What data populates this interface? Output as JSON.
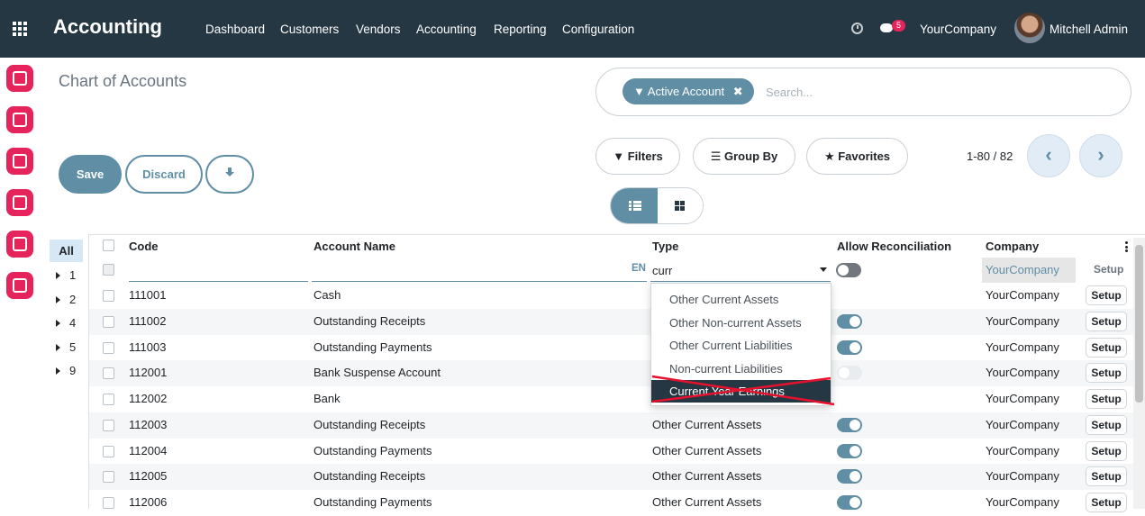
{
  "topbar": {
    "app_name": "Accounting",
    "menu": [
      "Dashboard",
      "Customers",
      "Vendors",
      "Accounting",
      "Reporting",
      "Configuration"
    ],
    "messages_count": "5",
    "company": "YourCompany",
    "user": "Mitchell Admin"
  },
  "page": {
    "breadcrumb": "Chart of Accounts"
  },
  "actions": {
    "save": "Save",
    "discard": "Discard"
  },
  "search": {
    "facet": "Active Account",
    "placeholder": "Search...",
    "filters": "Filters",
    "group_by": "Group By",
    "favorites": "Favorites"
  },
  "pager": {
    "value": "1-80 / 82"
  },
  "groups": {
    "all": "All",
    "items": [
      "1",
      "2",
      "4",
      "5",
      "9"
    ]
  },
  "table": {
    "headers": [
      "Code",
      "Account Name",
      "Type",
      "Allow Reconciliation",
      "Company"
    ],
    "edit_row": {
      "lang": "EN",
      "type_input": "curr",
      "company": "YourCompany",
      "setup": "Setup"
    },
    "rows": [
      {
        "code": "111001",
        "name": "Cash",
        "type": "",
        "reconcile": "none",
        "company": "YourCompany",
        "setup": "Setup"
      },
      {
        "code": "111002",
        "name": "Outstanding Receipts",
        "type": "",
        "reconcile": "on",
        "company": "YourCompany",
        "setup": "Setup"
      },
      {
        "code": "111003",
        "name": "Outstanding Payments",
        "type": "",
        "reconcile": "on",
        "company": "YourCompany",
        "setup": "Setup"
      },
      {
        "code": "112001",
        "name": "Bank Suspense Account",
        "type": "",
        "reconcile": "disabled",
        "company": "YourCompany",
        "setup": "Setup"
      },
      {
        "code": "112002",
        "name": "Bank",
        "type": "",
        "reconcile": "none",
        "company": "YourCompany",
        "setup": "Setup"
      },
      {
        "code": "112003",
        "name": "Outstanding Receipts",
        "type": "Other Current Assets",
        "reconcile": "on",
        "company": "YourCompany",
        "setup": "Setup"
      },
      {
        "code": "112004",
        "name": "Outstanding Payments",
        "type": "Other Current Assets",
        "reconcile": "on",
        "company": "YourCompany",
        "setup": "Setup"
      },
      {
        "code": "112005",
        "name": "Outstanding Receipts",
        "type": "Other Current Assets",
        "reconcile": "on",
        "company": "YourCompany",
        "setup": "Setup"
      },
      {
        "code": "112006",
        "name": "Outstanding Payments",
        "type": "Other Current Assets",
        "reconcile": "on",
        "company": "YourCompany",
        "setup": "Setup"
      }
    ]
  },
  "dropdown": {
    "options": [
      "Other Current Assets",
      "Other Non-current Assets",
      "Other Current Liabilities",
      "Non-current Liabilities",
      "Current Year Earnings"
    ],
    "active_index": 4
  },
  "colors": {
    "topbar": "#243742",
    "accent": "#5f8ea5",
    "app_icon": "#e4245b",
    "strike": "#e8112d"
  }
}
